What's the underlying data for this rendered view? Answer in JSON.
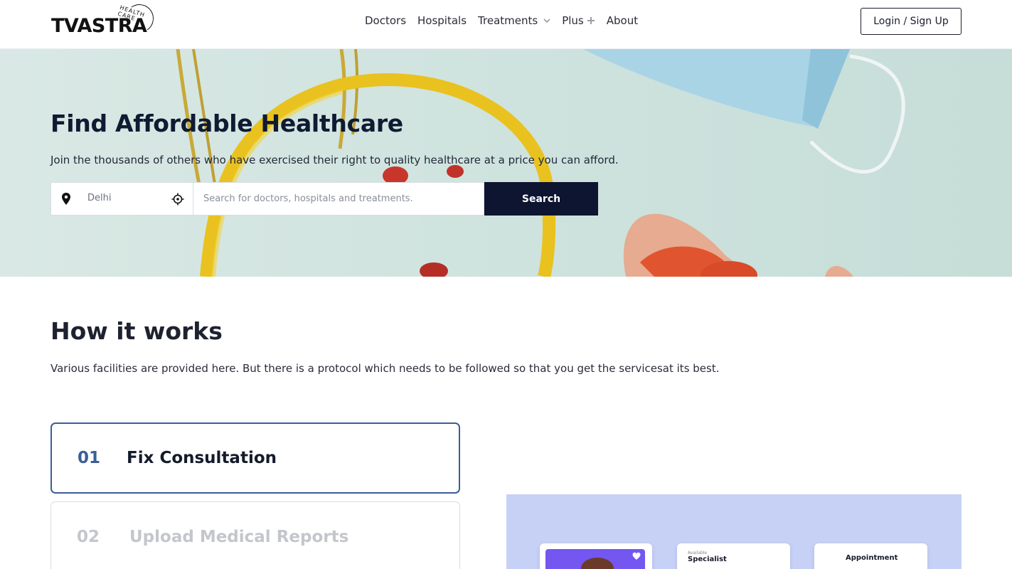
{
  "header": {
    "logo_text": "TVASTRA",
    "logo_tagline": "HEALTH CARE",
    "nav": [
      {
        "label": "Doctors",
        "icon": ""
      },
      {
        "label": "Hospitals",
        "icon": ""
      },
      {
        "label": "Treatments",
        "icon": "chevron-down-icon"
      },
      {
        "label": "Plus",
        "icon": "plus-icon"
      },
      {
        "label": "About",
        "icon": ""
      }
    ],
    "login_label": "Login / Sign Up"
  },
  "hero": {
    "title": "Find Affordable Healthcare",
    "subtitle": "Join the thousands of others who have exercised their right to quality healthcare at a price you can afford.",
    "location_value": "Delhi",
    "search_placeholder": "Search for doctors, hospitals and treatments.",
    "search_button": "Search"
  },
  "how_it_works": {
    "title": "How it works",
    "description": "Various facilities are provided here. But there is a protocol which needs to be followed so that you get the servicesat its best.",
    "steps": [
      {
        "number": "01",
        "label": "Fix Consultation",
        "active": true
      },
      {
        "number": "02",
        "label": "Upload Medical Reports",
        "active": false
      }
    ]
  },
  "preview": {
    "card2_small": "Available",
    "card2_title": "Specialist",
    "card3_title": "Appointment"
  },
  "colors": {
    "primary_dark": "#0d1530",
    "step_active": "#3b5e97",
    "preview_bg": "#c7d1f6",
    "accent_purple": "#7456f1"
  }
}
